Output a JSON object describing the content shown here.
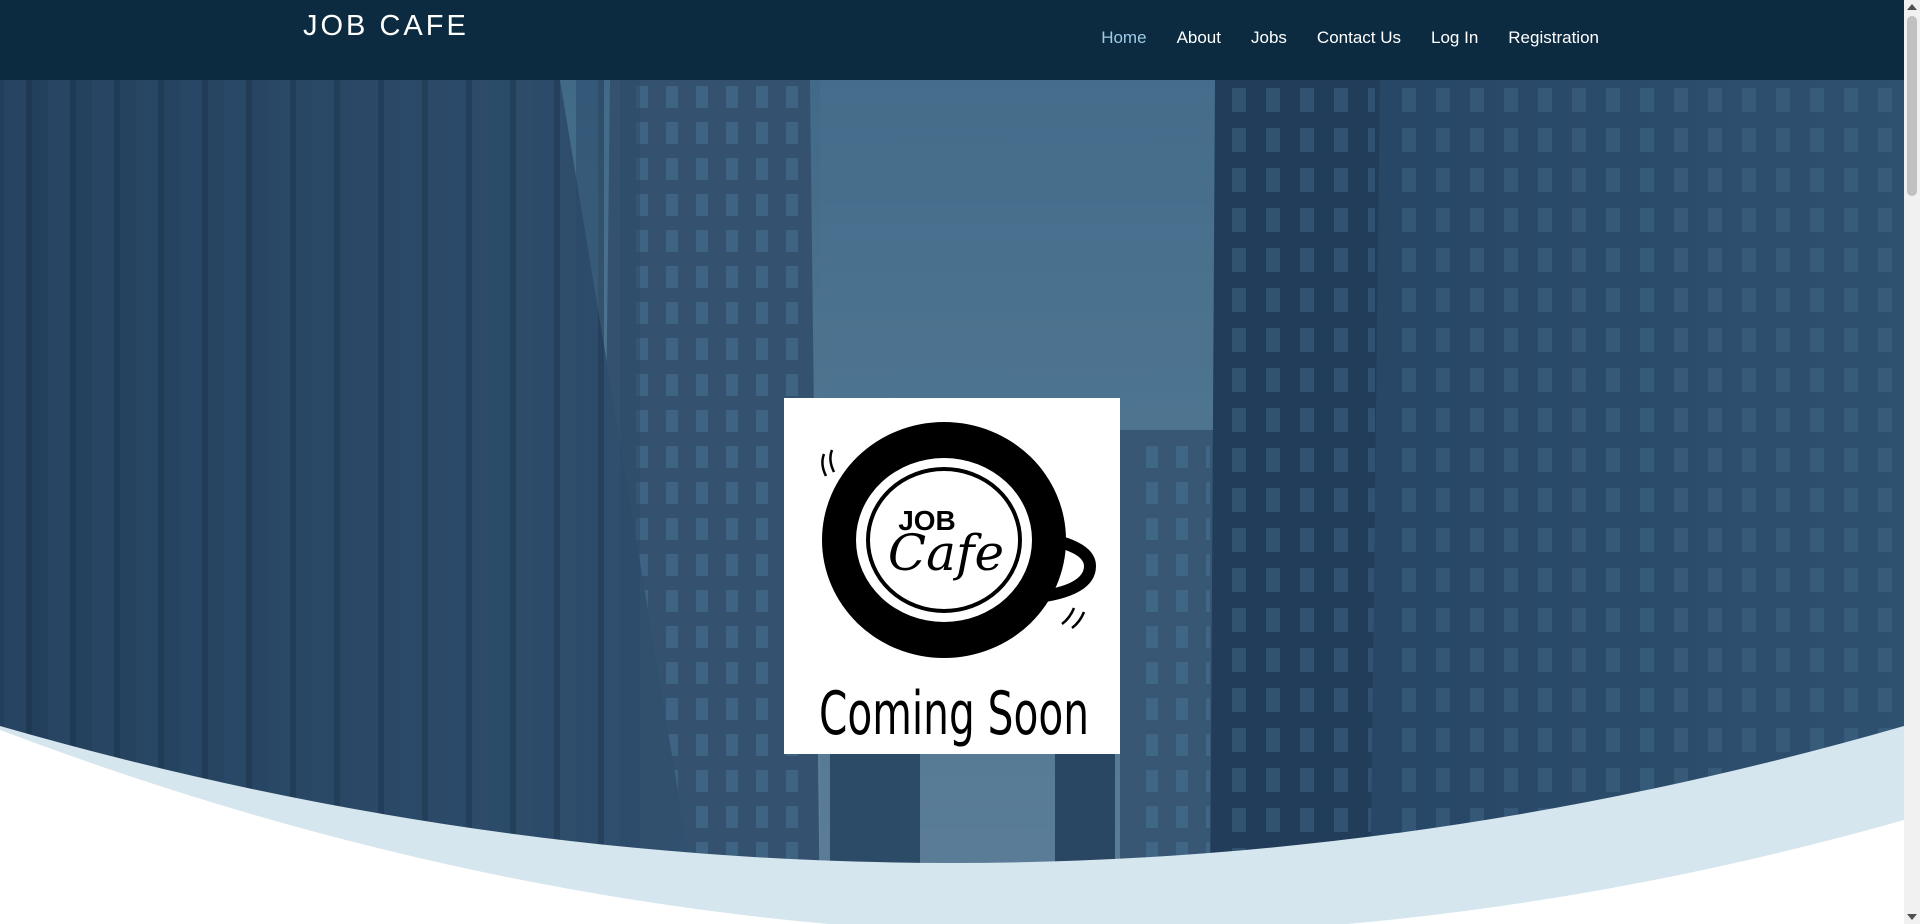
{
  "brand": {
    "name": "JOB CAFE"
  },
  "nav": {
    "items": [
      {
        "label": "Home",
        "active": true
      },
      {
        "label": "About",
        "active": false
      },
      {
        "label": "Jobs",
        "active": false
      },
      {
        "label": "Contact Us",
        "active": false
      },
      {
        "label": "Log In",
        "active": false
      },
      {
        "label": "Registration",
        "active": false
      }
    ]
  },
  "hero": {
    "background": "city-skyscrapers-photo",
    "logo": {
      "wordmark_top": "JOB",
      "wordmark_script": "Cafe",
      "tagline": "Coming Soon",
      "icon": "coffee-cup-icon"
    }
  },
  "colors": {
    "navbar": "#0c2b40",
    "nav_active": "#9ecbe6",
    "hero_tint": "#2c4f6e",
    "wave_accent": "#d6e6ee"
  }
}
